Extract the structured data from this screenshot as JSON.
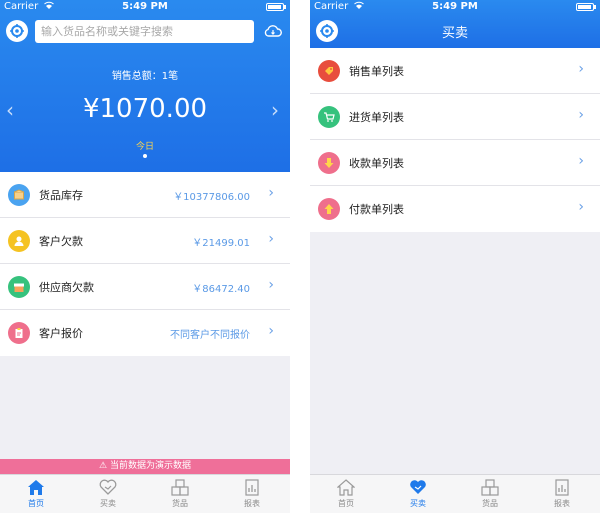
{
  "status_bar": {
    "carrier": "Carrier",
    "time": "5:49 PM"
  },
  "home": {
    "search_placeholder": "输入货品名称或关键字搜索",
    "sales_total_label": "销售总额：1笔",
    "amount": "¥1070.00",
    "period": "今日",
    "rows": [
      {
        "label": "货品库存",
        "value": "￥10377806.00",
        "icon": "box-icon",
        "color": "#4aa3f0"
      },
      {
        "label": "客户欠款",
        "value": "￥21499.01",
        "icon": "person-icon",
        "color": "#f5c322"
      },
      {
        "label": "供应商欠款",
        "value": "￥86472.40",
        "icon": "store-icon",
        "color": "#36c27d"
      },
      {
        "label": "客户报价",
        "value": "不同客户不同报价",
        "icon": "clipboard-icon",
        "color": "#ef6f8c"
      }
    ],
    "demo_banner": "⚠ 当前数据为演示数据"
  },
  "trade": {
    "title": "买卖",
    "rows": [
      {
        "label": "销售单列表",
        "icon": "tag-icon",
        "color": "#e84d3d"
      },
      {
        "label": "进货单列表",
        "icon": "cart-icon",
        "color": "#36c27d"
      },
      {
        "label": "收款单列表",
        "icon": "arrow-down-icon",
        "color": "#ef6f8c"
      },
      {
        "label": "付款单列表",
        "icon": "arrow-up-icon",
        "color": "#ef6f8c"
      }
    ]
  },
  "tabs": {
    "left": [
      {
        "label": "首页",
        "active": true
      },
      {
        "label": "买卖",
        "active": false
      },
      {
        "label": "货品",
        "active": false
      },
      {
        "label": "报表",
        "active": false
      }
    ],
    "right": [
      {
        "label": "首页",
        "active": false
      },
      {
        "label": "买卖",
        "active": true
      },
      {
        "label": "货品",
        "active": false
      },
      {
        "label": "报表",
        "active": false
      }
    ]
  },
  "colors": {
    "brand_blue": "#1f7aea",
    "demo_pink": "#ef6f99",
    "value_blue": "#5b9ae6"
  }
}
